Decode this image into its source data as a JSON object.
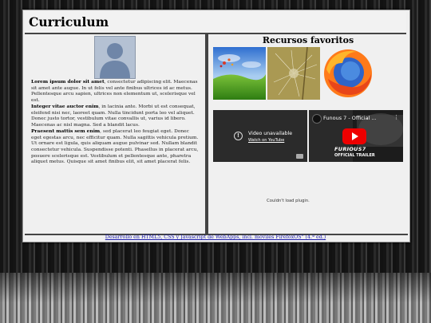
{
  "header": {
    "title": "Curriculum"
  },
  "profile": {
    "avatar_icon": "person-silhouette-icon",
    "paragraphs": [
      {
        "lead": "Lorem ipsum dolor sit amet",
        "text": ", consectetur adipiscing elit. Maecenas sit amet ante augue. In ut felis vel ante finibus ultrices id ac metus. Pellentesque arcu sapien, ultrices non elementum ut, scelerisque vel est."
      },
      {
        "lead": "Integer vitae auctor enim",
        "text": ", in lacinia ante. Morbi ut est consequat, eleifend nisi nec, laoreet quam. Nulla tincidunt porta leo vel aliquet. Donec justo tortor, vestibulum vitae convallis ut, varius id libero. Maecenas ac nisl magna. Sed a blandit lacus."
      },
      {
        "lead": "Praesent mattis sem enim",
        "text": ", sed placerat leo feugiat eget. Donec eget egestas arcu, nec efficitur quam. Nulla sagittis vehicula pretium. Ut ornare est ligula, quis aliquam augue pulvinar sed. Nullam blandit consectetur vehicula. Suspendisse potenti. Phasellus in placerat arcu, posuere scelerisque est. Vestibulum et pellentesque ante, pharetra aliquet metus. Quisque sit amet finibus elit, sit amet placerat felis."
      }
    ]
  },
  "favorites": {
    "title": "Recursos favoritos",
    "images": [
      "landscape-balloons-icon",
      "dandelion-seeds-icon",
      "firefox-logo-icon"
    ],
    "video_unavailable": {
      "message": "Video unavailable",
      "link": "Watch on YouTube"
    },
    "video_trailer": {
      "title": "Funous 7 - Official ...",
      "brand_line1": "FURIOUS",
      "brand_number": "7",
      "brand_line2": "OFFICIAL TRAILER"
    },
    "plugin_message": "Couldn't load plugin."
  },
  "footer": {
    "link": "Desarrollo en HTML5, CSS y Javascript de WebApps, incl. móviles FirefoxOS\" (4.ª ed.)"
  },
  "colors": {
    "link": "#1a1aaa",
    "border": "#444444",
    "panel": "#f0f0f0"
  }
}
